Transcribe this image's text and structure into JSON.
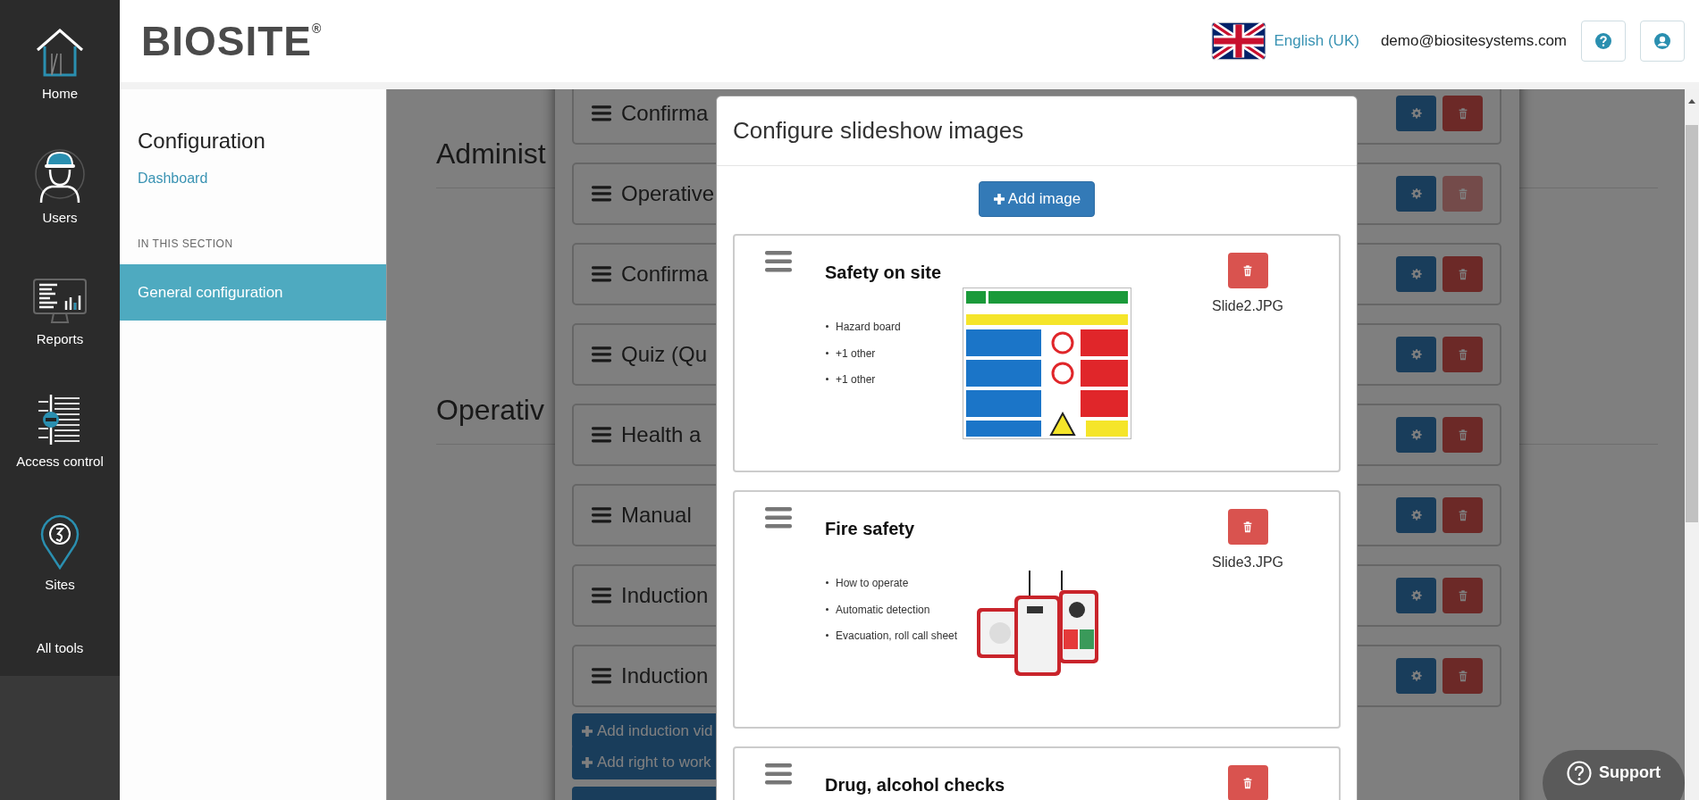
{
  "nav": {
    "items": [
      {
        "label": "Home",
        "kind": "home"
      },
      {
        "label": "Users",
        "kind": "users"
      },
      {
        "label": "Reports",
        "kind": "reports"
      },
      {
        "label": "Access control",
        "kind": "access"
      },
      {
        "label": "Sites",
        "kind": "sites"
      },
      {
        "label": "All tools",
        "kind": "text"
      }
    ]
  },
  "header": {
    "logo": "BIOSITE",
    "logo_mark": "®",
    "language": "English (UK)",
    "email": "demo@biositesystems.com"
  },
  "section_sidebar": {
    "title": "Configuration",
    "link": "Dashboard",
    "section_label": "IN THIS SECTION",
    "items": [
      {
        "label": "General configuration",
        "selected": true
      }
    ]
  },
  "page": {
    "headings": [
      "Administ",
      "Operativ"
    ]
  },
  "list_modal": {
    "rows": [
      {
        "label": "Confirma",
        "delete_disabled": false
      },
      {
        "label": "Operative",
        "delete_disabled": true
      },
      {
        "label": "Confirma",
        "delete_disabled": false
      },
      {
        "label": "Quiz (Qu",
        "delete_disabled": false
      },
      {
        "label": "Health a",
        "delete_disabled": false
      },
      {
        "label": "Manual",
        "delete_disabled": false
      },
      {
        "label": "Induction",
        "delete_disabled": false
      },
      {
        "label": "Induction",
        "delete_disabled": false
      }
    ],
    "buttons": [
      "Add induction vid",
      "Add right to work"
    ]
  },
  "slides_modal": {
    "title": "Configure slideshow images",
    "add_button": "Add image",
    "slides": [
      {
        "title": "Safety on site",
        "bullets": [
          "Hazard board",
          "+1 other",
          "+1 other"
        ],
        "file": "Slide2.JPG",
        "kind": "picture"
      },
      {
        "title": "Fire safety",
        "bullets": [
          "How to operate",
          "Automatic detection",
          "Evacuation, roll call sheet"
        ],
        "file": "Slide3.JPG",
        "kind": "picture"
      },
      {
        "title": "Drug, alcohol checks"
      }
    ]
  },
  "support": {
    "label": "Support"
  }
}
